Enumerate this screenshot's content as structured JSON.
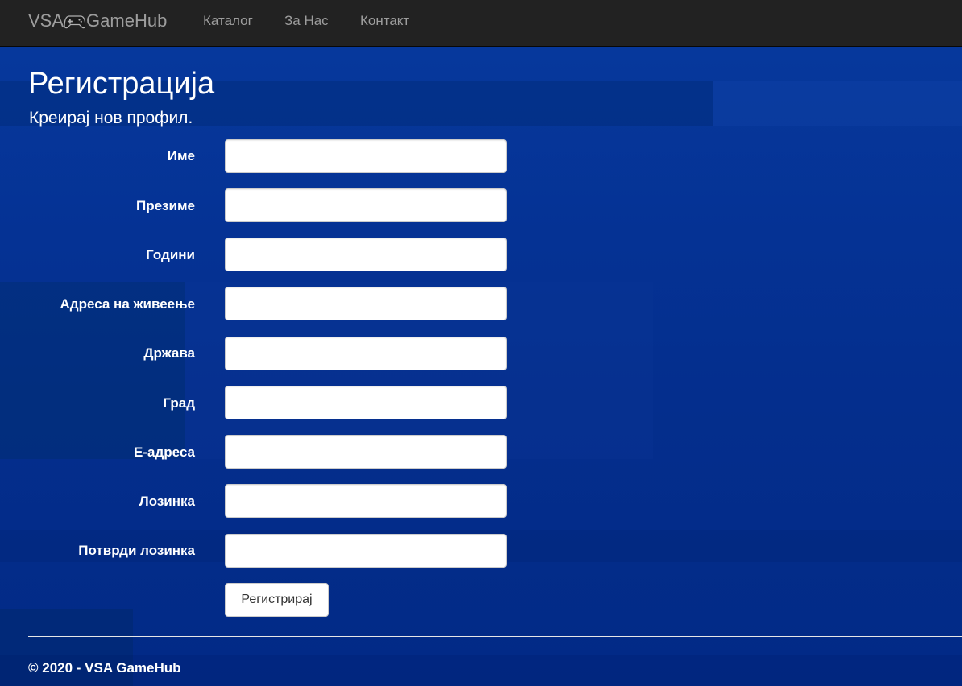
{
  "navbar": {
    "brand_left": "VSA",
    "brand_right": "GameHub",
    "links": [
      "Каталог",
      "За Нас",
      "Контакт"
    ]
  },
  "page": {
    "title": "Регистрација",
    "subtitle": "Креирај нов профил."
  },
  "form": {
    "fields": [
      {
        "label": "Име",
        "value": ""
      },
      {
        "label": "Презиме",
        "value": ""
      },
      {
        "label": "Години",
        "value": ""
      },
      {
        "label": "Адреса на живеење",
        "value": ""
      },
      {
        "label": "Држава",
        "value": ""
      },
      {
        "label": "Град",
        "value": ""
      },
      {
        "label": "Е-адреса",
        "value": ""
      },
      {
        "label": "Лозинка",
        "value": ""
      },
      {
        "label": "Потврди лозинка",
        "value": ""
      }
    ],
    "submit_label": "Регистрирај"
  },
  "footer": {
    "text": "© 2020 - VSA GameHub"
  },
  "icons": {
    "brand_icon": "gamepad-icon"
  },
  "colors": {
    "navbar_bg": "#222222",
    "nav_text": "#9d9d9d",
    "page_bg": "#042c8c",
    "text": "#ffffff"
  }
}
